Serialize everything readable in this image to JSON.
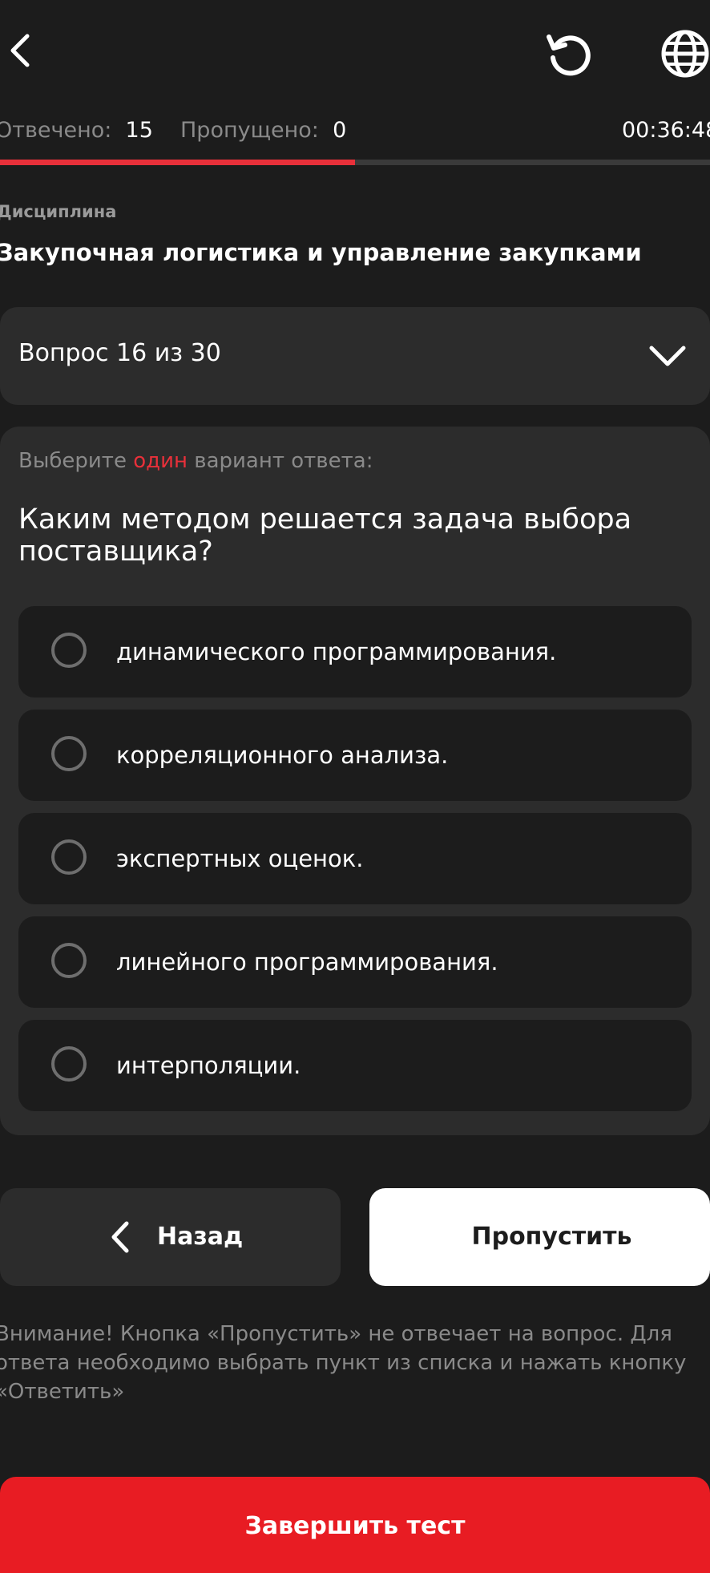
{
  "colors": {
    "background": "#1c1c1c",
    "surface": "#2c2c2c",
    "accent": "#e8303a",
    "finish_button": "#e81c23",
    "muted_text": "#8a8a8a"
  },
  "icons": {
    "back": "chevron-left-icon",
    "reset": "rotate-ccw-icon",
    "language": "globe-icon",
    "expand": "chevron-down-icon",
    "radio": "radio-unchecked-icon"
  },
  "header": {
    "answered_label": "Отвечено:",
    "answered_value": "15",
    "skipped_label": "Пропущено:",
    "skipped_value": "0",
    "timer": "00:36:48",
    "progress_fraction": 0.5
  },
  "discipline": {
    "label": "Дисциплина",
    "title": "Закупочная логистика и управление закупками"
  },
  "question_selector": {
    "label": "Вопрос 16 из 30"
  },
  "question": {
    "instruction_before": "Выберите ",
    "instruction_accent": "один",
    "instruction_after": " вариант ответа:",
    "text": "Каким методом решается задача выбора поставщика?",
    "options": [
      "динамического программирования.",
      "корреляционного анализа.",
      "экспертных оценок.",
      "линейного программирования.",
      "интерполяции."
    ]
  },
  "buttons": {
    "back_label": "Назад",
    "skip_label": "Пропустить",
    "finish_label": "Завершить тест"
  },
  "warning_text": "Внимание! Кнопка «Пропустить» не отвечает на вопрос. Для ответа необходимо выбрать пункт из списка и нажать кнопку «Ответить»"
}
